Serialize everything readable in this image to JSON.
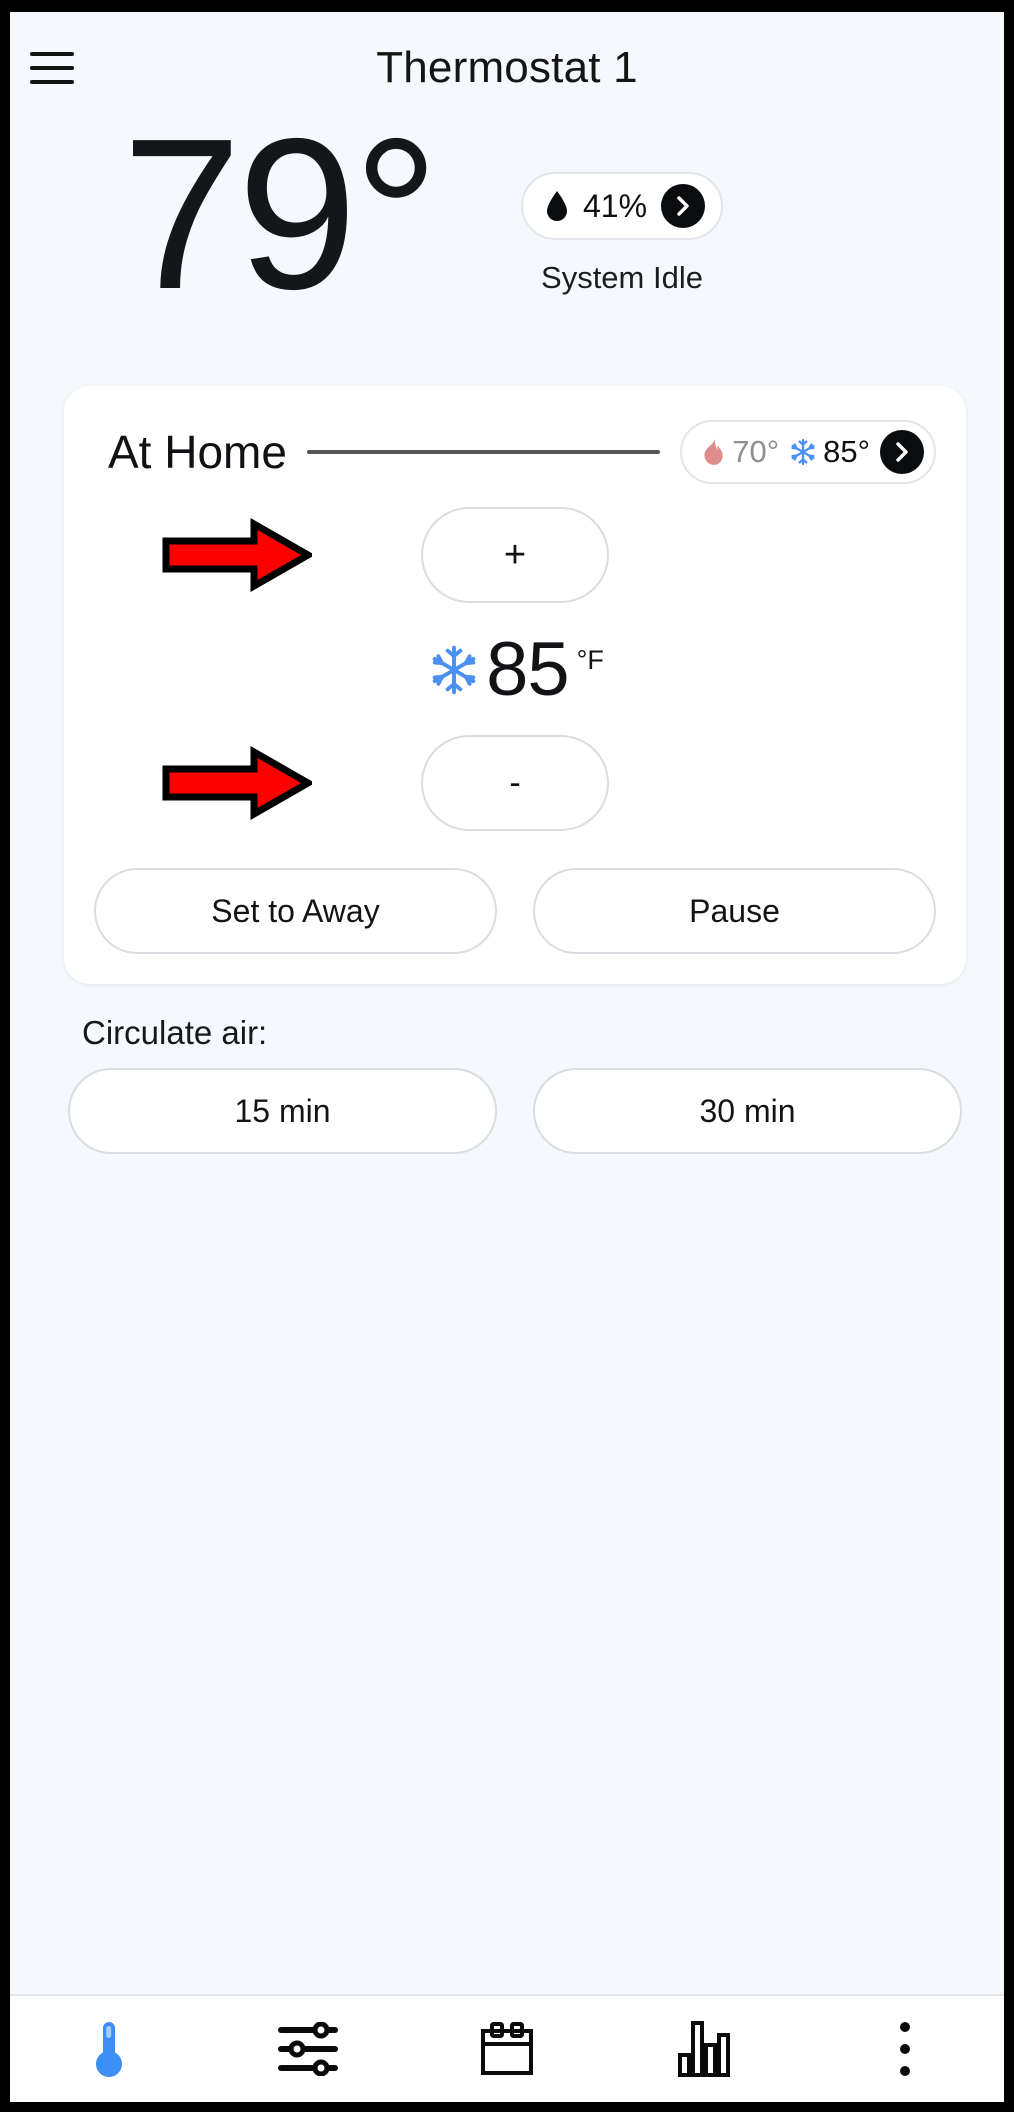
{
  "header": {
    "menu_icon": "hamburger-menu-icon",
    "title": "Thermostat 1"
  },
  "hero": {
    "current_temperature": "79°",
    "humidity": {
      "icon": "water-drop-icon",
      "value": "41%",
      "chevron": "chevron-right-icon"
    },
    "system_status": "System Idle"
  },
  "card": {
    "mode_name": "At Home",
    "setpoint_pill": {
      "heat_icon": "flame-icon",
      "heat_value": "70°",
      "cool_icon": "snowflake-icon",
      "cool_value": "85°",
      "chevron": "chevron-right-icon"
    },
    "increase_button": "+",
    "decrease_button": "-",
    "current_setpoint": {
      "icon": "snowflake-icon",
      "value": "85",
      "unit": "°F"
    },
    "actions": [
      {
        "label": "Set to Away",
        "name": "set-to-away-button"
      },
      {
        "label": "Pause",
        "name": "pause-button"
      }
    ],
    "annotations": [
      {
        "name": "annotation-arrow-increase",
        "target": "increase-temperature-button"
      },
      {
        "name": "annotation-arrow-decrease",
        "target": "decrease-temperature-button"
      }
    ]
  },
  "circulate": {
    "label": "Circulate air:",
    "options": [
      {
        "label": "15 min",
        "name": "circulate-15-min-button"
      },
      {
        "label": "30 min",
        "name": "circulate-30-min-button"
      }
    ]
  },
  "bottom_nav": {
    "items": [
      {
        "name": "nav-thermostat",
        "icon": "thermometer-icon",
        "active": true
      },
      {
        "name": "nav-settings",
        "icon": "sliders-icon",
        "active": false
      },
      {
        "name": "nav-schedule",
        "icon": "calendar-icon",
        "active": false
      },
      {
        "name": "nav-usage",
        "icon": "bar-chart-icon",
        "active": false
      },
      {
        "name": "nav-more",
        "icon": "more-vertical-icon",
        "active": false
      }
    ]
  },
  "colors": {
    "screen_background": "#f5f8fc",
    "card_background": "#ffffff",
    "accent_blue": "#4a90f0",
    "heat_red": "#e08c8c",
    "annotation_red": "#fd0000",
    "text_primary": "#121316",
    "text_muted": "#8e8e93",
    "border": "#d9dde2"
  }
}
